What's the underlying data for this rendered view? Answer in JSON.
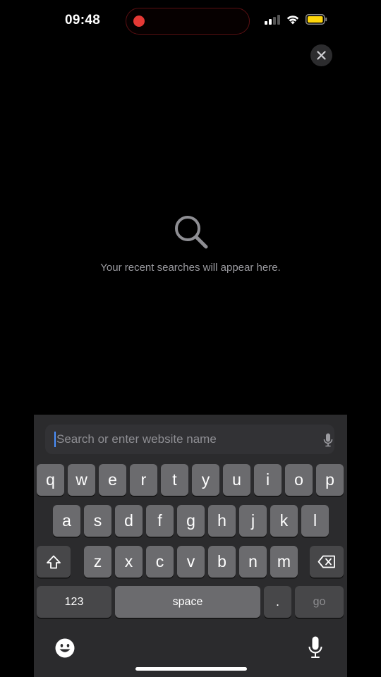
{
  "status_bar": {
    "time": "09:48",
    "recording_color": "#e53935",
    "battery_color": "#ffd60a",
    "icons": [
      "signal-icon",
      "wifi-icon",
      "battery-icon"
    ]
  },
  "close_button": {
    "icon": "close-icon"
  },
  "empty_state": {
    "icon": "search-icon",
    "message": "Your recent searches will appear here."
  },
  "search": {
    "value": "",
    "placeholder": "Search or enter website name",
    "mic_icon": "microphone-icon"
  },
  "keyboard": {
    "row1": [
      "q",
      "w",
      "e",
      "r",
      "t",
      "y",
      "u",
      "i",
      "o",
      "p"
    ],
    "row2": [
      "a",
      "s",
      "d",
      "f",
      "g",
      "h",
      "j",
      "k",
      "l"
    ],
    "row3": [
      "z",
      "x",
      "c",
      "v",
      "b",
      "n",
      "m"
    ],
    "shift_icon": "shift-icon",
    "backspace_icon": "backspace-icon",
    "numbers_label": "123",
    "space_label": "space",
    "period_label": ".",
    "go_label": "go",
    "emoji_icon": "emoji-icon",
    "dictation_icon": "microphone-icon"
  }
}
